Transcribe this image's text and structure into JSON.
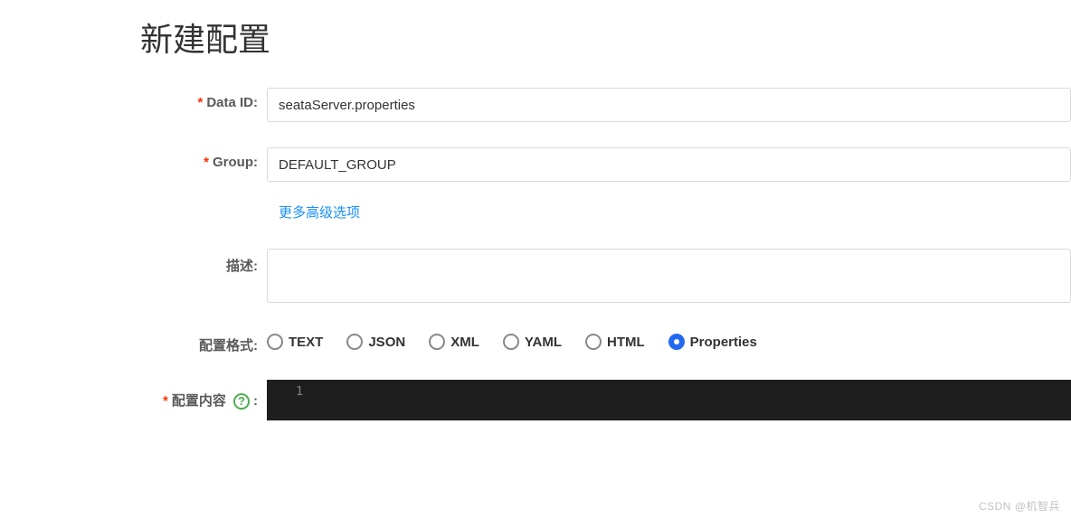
{
  "title": "新建配置",
  "fields": {
    "dataId": {
      "label": "Data ID:",
      "value": "seataServer.properties"
    },
    "group": {
      "label": "Group:",
      "value": "DEFAULT_GROUP"
    },
    "description": {
      "label": "描述:",
      "value": ""
    },
    "format": {
      "label": "配置格式:"
    },
    "content": {
      "label": "配置内容",
      "colon": ":"
    }
  },
  "moreOptions": "更多高级选项",
  "formats": [
    {
      "label": "TEXT",
      "checked": false
    },
    {
      "label": "JSON",
      "checked": false
    },
    {
      "label": "XML",
      "checked": false
    },
    {
      "label": "YAML",
      "checked": false
    },
    {
      "label": "HTML",
      "checked": false
    },
    {
      "label": "Properties",
      "checked": true
    }
  ],
  "editor": {
    "lineNumber": "1"
  },
  "watermark": "CSDN @机智兵"
}
